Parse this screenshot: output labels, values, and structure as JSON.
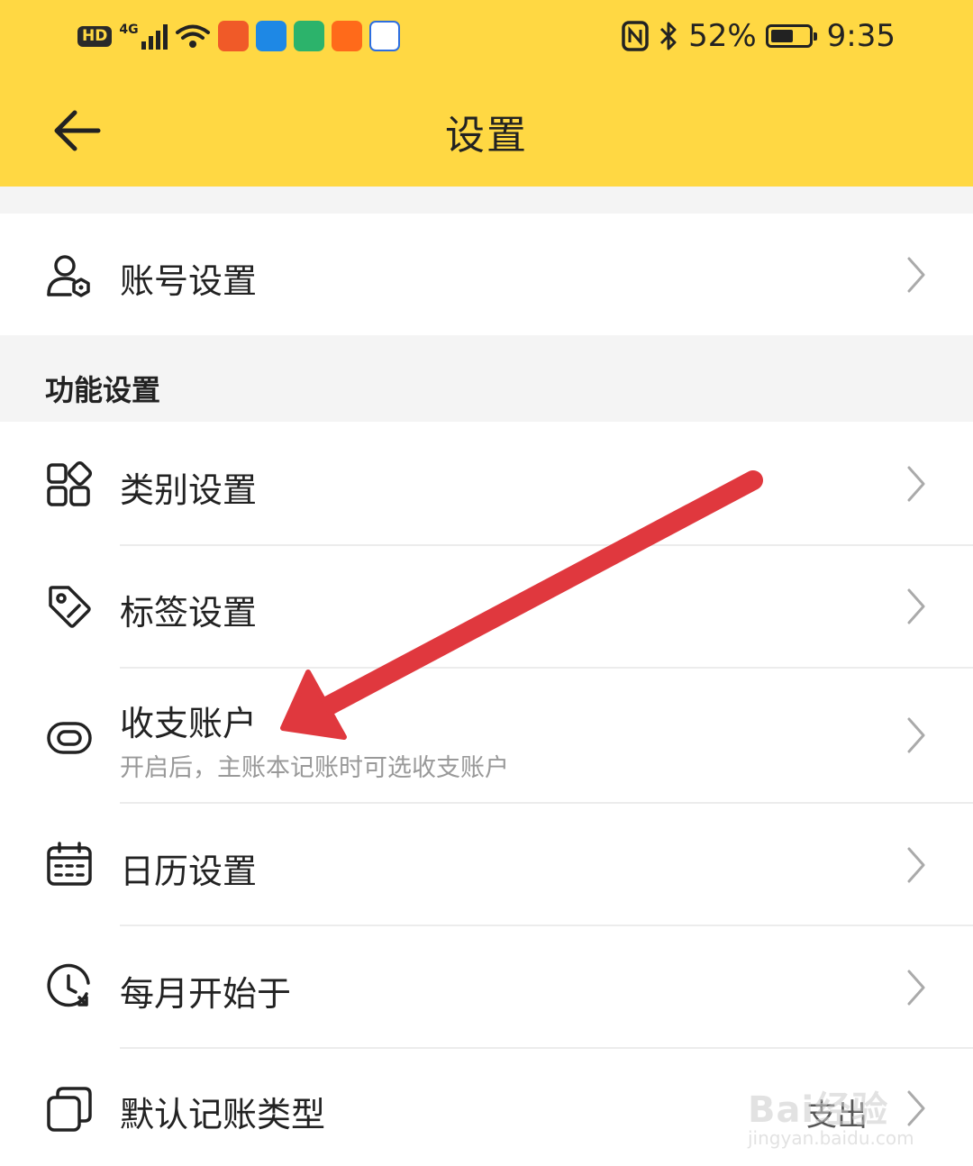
{
  "status_bar": {
    "hd_label": "HD",
    "network_label": "4G",
    "battery_percent": "52%",
    "time": "9:35"
  },
  "header": {
    "title": "设置"
  },
  "account_item": {
    "label": "账号设置",
    "icon": "user-settings-icon"
  },
  "section": {
    "label": "功能设置"
  },
  "items": [
    {
      "label": "类别设置",
      "icon": "category-grid-icon"
    },
    {
      "label": "标签设置",
      "icon": "tag-icon"
    },
    {
      "label": "收支账户",
      "subtitle": "开启后，主账本记账时可选收支账户",
      "icon": "link-icon"
    },
    {
      "label": "日历设置",
      "icon": "calendar-icon"
    },
    {
      "label": "每月开始于",
      "icon": "clock-icon"
    },
    {
      "label": "默认记账类型",
      "value": "支出",
      "icon": "copy-icon"
    }
  ],
  "watermark": {
    "brand": "Bai经验",
    "url": "jingyan.baidu.com"
  },
  "colors": {
    "header_bg": "#ffd843",
    "arrow": "#e0383e"
  }
}
